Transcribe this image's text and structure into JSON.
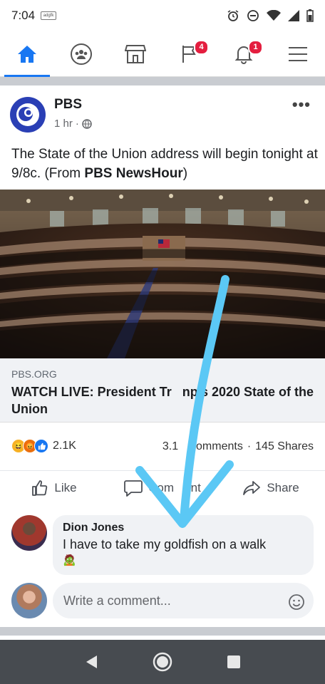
{
  "status_bar": {
    "time": "7:04",
    "app_icon_text": "adgfk"
  },
  "nav": {
    "tabs": [
      {
        "name": "home",
        "icon": "home-icon",
        "active": true
      },
      {
        "name": "groups",
        "icon": "groups-icon",
        "active": false
      },
      {
        "name": "marketplace",
        "icon": "marketplace-icon",
        "active": false
      },
      {
        "name": "pages",
        "icon": "flag-icon",
        "badge": "4"
      },
      {
        "name": "notifications",
        "icon": "bell-icon",
        "badge": "1"
      },
      {
        "name": "menu",
        "icon": "hamburger-menu-icon"
      }
    ],
    "accent": "#1877f2"
  },
  "post": {
    "page_name": "PBS",
    "time": "1 hr",
    "privacy_icon": "globe-icon",
    "text_before": "The State of the Union address will begin tonight at 9/8c. (From ",
    "text_bold": "PBS NewsHour",
    "text_after": ")",
    "link_domain": "PBS.ORG",
    "link_title": "WATCH LIVE: President Tr   np's 2020 State of the Union",
    "reaction_count": "2.1K",
    "comments_count": "3.1   Comments",
    "shares_count": "145 Shares",
    "actions": {
      "like": "Like",
      "comment": "Com   ent",
      "share": "Share"
    }
  },
  "comment": {
    "author": "Dion Jones",
    "text": "I have to take my goldfish on a walk",
    "emoji": "🧟"
  },
  "write_comment": {
    "placeholder": "Write a comment..."
  },
  "colors": {
    "annotation_arrow": "#5bc8f5",
    "pbs_blue": "#2a3fb5"
  }
}
